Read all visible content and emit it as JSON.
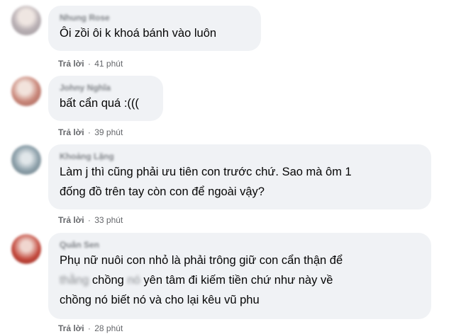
{
  "comments": [
    {
      "author": "Nhung Rose",
      "text": "Ôi zồi ôi k khoá bánh vào luôn",
      "reply_label": "Trả lời",
      "separator": "·",
      "time": "41 phút"
    },
    {
      "author": "Johny Nghĩa",
      "text": "bất cẩn quá :(((",
      "reply_label": "Trả lời",
      "separator": "·",
      "time": "39 phút"
    },
    {
      "author": "Khoảng Lặng",
      "line1": "Làm j thì cũng phải ưu tiên con trước chứ. Sao mà ôm 1",
      "line2": "đống đồ trên tay còn con để ngoài vậy?",
      "reply_label": "Trả lời",
      "separator": "·",
      "time": "33 phút"
    },
    {
      "author": "Quân Sen",
      "line1": "Phụ nữ nuôi con nhỏ là phải trông giữ con cẩn thận để",
      "line2_blur1": "thằng",
      "line2_a": "chồng",
      "line2_blur2": "nó",
      "line2_b": "yên tâm đi kiếm tiền chứ như này về",
      "line3": "chồng nó biết nó và cho lại kêu vũ phu",
      "reply_label": "Trả lời",
      "separator": "·",
      "time": "28 phút"
    }
  ],
  "avatar_colors": [
    "#c9c4c8",
    "#c79a8f",
    "#8fa3ad",
    "#b3453a"
  ]
}
